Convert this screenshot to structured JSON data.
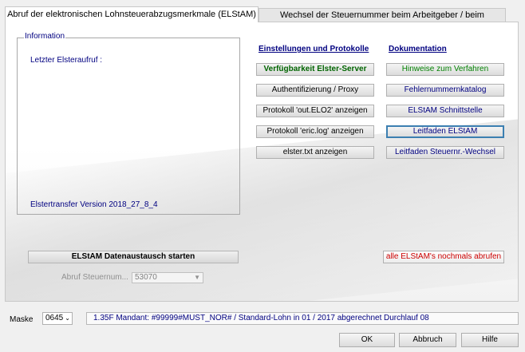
{
  "tabs": {
    "active": "Abruf der elektronischen Lohnsteuerabzugsmerkmale (ELStAM)",
    "inactive": "Wechsel der Steuernummer beim Arbeitgeber / beim Versender"
  },
  "info": {
    "legend": "Information",
    "last_call_label": "Letzter Elsteraufruf  :",
    "version": "Elstertransfer Version 2018_27_8_4"
  },
  "settings": {
    "heading": "Einstellungen und Protokolle",
    "buttons": [
      "Verfügbarkeit Elster-Server",
      "Authentifizierung / Proxy",
      "Protokoll 'out.ELO2' anzeigen",
      "Protokoll 'eric.log' anzeigen",
      "elster.txt anzeigen"
    ]
  },
  "docs": {
    "heading": "Dokumentation",
    "buttons": [
      "Hinweise zum Verfahren",
      "Fehlernummernkatalog",
      "ELStAM Schnittstelle",
      "Leitfaden ELStAM",
      "Leitfaden Steuernr.-Wechsel"
    ]
  },
  "actions": {
    "start": "ELStAM Datenaustausch starten",
    "refetch": "alle ELStAM's nochmals abrufen"
  },
  "abruf": {
    "label": "Abruf Steuernum...",
    "value": "53070"
  },
  "footer": {
    "maske_label": "Maske",
    "maske_value": "0645",
    "status_text": "1.35F Mandant: #99999#MUST_NOR# / Standard-Lohn in 01 / 2017 abgerechnet",
    "status_run": "Durchlauf 08",
    "ok": "OK",
    "cancel": "Abbruch",
    "help": "Hilfe"
  },
  "colors": {
    "navy": "#000080",
    "green": "#006400",
    "red": "#cc0000",
    "focus": "#3c7fb1"
  }
}
